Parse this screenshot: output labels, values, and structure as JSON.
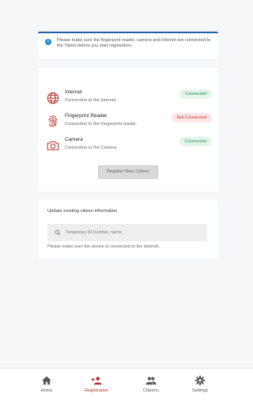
{
  "info": {
    "text": "Please make sure the fingerprint reader, camera and internet are connected to the Tablet before you start registration."
  },
  "status": {
    "items": [
      {
        "title": "Internet",
        "subtitle": "Connection to the Internet.",
        "status": "Connected",
        "icon": "globe-icon"
      },
      {
        "title": "Fingerprint Reader",
        "subtitle": "Connection to the Fingerprint reader.",
        "status": "Not Connected",
        "icon": "fingerprint-icon"
      },
      {
        "title": "Camera",
        "subtitle": "Connection to the Camera.",
        "status": "Connected",
        "icon": "camera-icon"
      }
    ],
    "register_label": "Register New Citizen"
  },
  "update": {
    "title": "Update existing citizen information",
    "search_placeholder": "Temporary ID number, name",
    "note": "Please make sure the device is connected to the internet."
  },
  "nav": {
    "items": [
      {
        "label": "Home",
        "icon": "home-icon"
      },
      {
        "label": "Registration",
        "icon": "person-add-icon"
      },
      {
        "label": "Citizens",
        "icon": "people-icon"
      },
      {
        "label": "Settings",
        "icon": "gear-icon"
      }
    ],
    "active": "Registration"
  },
  "colors": {
    "accent": "#b8322f",
    "info_border": "#1f5fa8",
    "info_icon": "#1e88e5",
    "connected_bg": "#e3f5e8",
    "connected_text": "#2e8b57",
    "not_connected_bg": "#fde5e5",
    "not_connected_text": "#c0392b"
  }
}
